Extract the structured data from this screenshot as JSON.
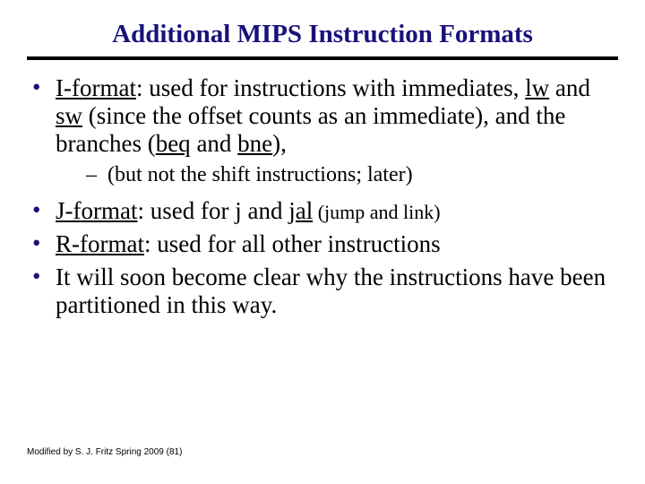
{
  "title": "Additional MIPS Instruction Formats",
  "bullets": {
    "b1": {
      "prefix": "I-format",
      "t1": ": used for instructions with immediates, ",
      "lw": "lw",
      "t2": " and ",
      "sw": "sw",
      "t3a": " (since the offset counts as an immediate), and the branches",
      "t3b": "(",
      "beq": "beq",
      "t4": " and ",
      "bne": "bne",
      "t5": "),",
      "sub": "(but not the shift instructions; later)"
    },
    "b2": {
      "prefix": "J-format",
      "t1": ": used for ",
      "j": "j",
      "t2": " and ",
      "jal": "jal",
      "t3": " (jump and link)"
    },
    "b3": {
      "prefix": "R-format",
      "t1": ": used for all other instructions"
    },
    "b4": {
      "t1": "It will soon become clear why the instructions have been partitioned in this way."
    }
  },
  "footer": "Modified by S. J. Fritz Spring 2009 (81)"
}
